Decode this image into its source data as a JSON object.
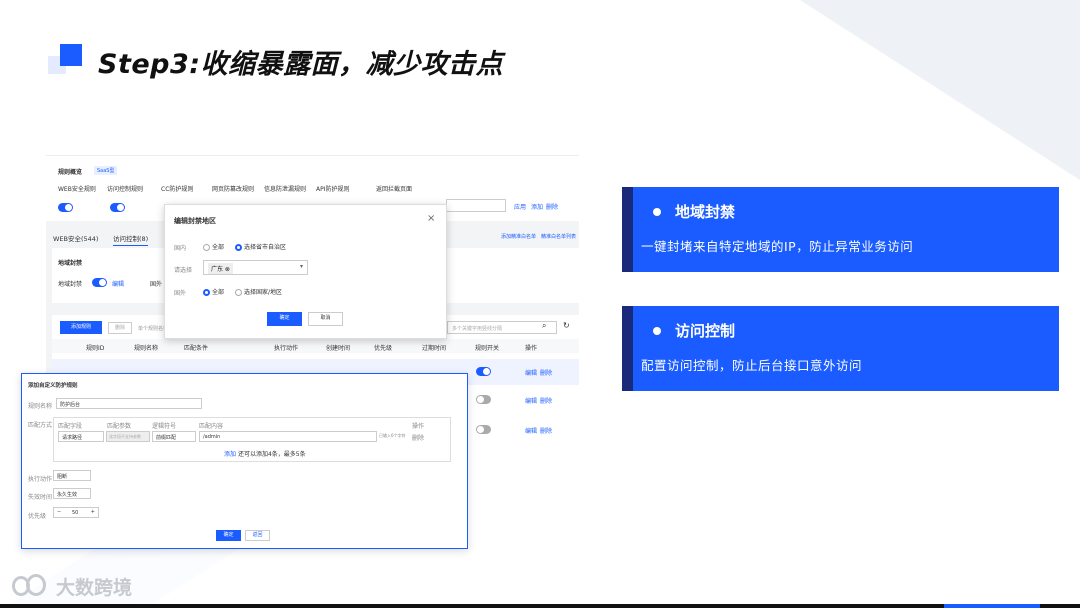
{
  "slide": {
    "title": "Step3:收缩暴露面，减少攻击点",
    "logo_text": "大数跨境"
  },
  "callouts": [
    {
      "heading": "地域封禁",
      "body": "一键封堵来自特定地域的IP，防止异常业务访问"
    },
    {
      "heading": "访问控制",
      "body": "配置访问控制，防止后台接口意外访问"
    }
  ],
  "screenshot": {
    "header": {
      "rule_overview": "规则概览",
      "saas_badge": "SaaS型",
      "rules": [
        "WEB安全规则",
        "访问控制规则",
        "CC防护规则",
        "网页防篡改规则",
        "信息防泄漏规则",
        "API防护规则",
        "返回拦截页面"
      ],
      "right_links": [
        "应用",
        "添加",
        "删除"
      ]
    },
    "tabs": [
      "WEB安全(544)",
      "访问控制(8)"
    ],
    "tab_right_links": [
      "添加精准白名单",
      "精准白名单列表"
    ],
    "geo_block": {
      "title": "地域封禁",
      "label": "地域封禁",
      "edit": "编辑",
      "overseas_label": "国外"
    },
    "toolbar": {
      "add_rule": "添加规则",
      "delete": "删除",
      "hint": "单个规则名称",
      "search_placeholder": "多个关键字用竖线分隔"
    },
    "table": {
      "headers": [
        "规则ID",
        "规则名称",
        "匹配条件",
        "执行动作",
        "创建时间",
        "优先级",
        "过期时间",
        "规则开关",
        "操作"
      ],
      "rows": [
        {
          "switch": true,
          "ops": [
            "编辑",
            "删除"
          ]
        },
        {
          "switch": false,
          "ops": [
            "编辑",
            "删除"
          ]
        },
        {
          "switch": false,
          "ops": [
            "编辑",
            "删除"
          ]
        }
      ]
    },
    "geo_modal": {
      "title": "编辑封禁地区",
      "domestic_label": "国内",
      "opt_all": "全部",
      "opt_select_region": "选择省市自治区",
      "select_label": "请选择",
      "selected_tag": "广东",
      "overseas_label": "国外",
      "opt_all_2": "全部",
      "opt_select_country": "选择国家/地区",
      "confirm": "确定",
      "cancel": "取消"
    },
    "custom_modal": {
      "title": "添加自定义防护规则",
      "name_label": "规则名称",
      "name_value": "防护后台",
      "match_label": "匹配方式",
      "cols": [
        "匹配字段",
        "匹配参数",
        "逻辑符号",
        "匹配内容",
        "操作"
      ],
      "row": {
        "field": "请求路径",
        "param": "该字段不支持参数",
        "logic": "前缀匹配",
        "content": "/admin",
        "limit": "已输入6个字符",
        "op": "删除"
      },
      "add_hint_link": "添加",
      "add_hint_text": "还可以添加4条，最多5条",
      "action_label": "执行动作",
      "action_value": "阻断",
      "expire_label": "失效时间",
      "expire_value": "永久生效",
      "priority_label": "优先级",
      "priority_value": "50",
      "confirm": "确定",
      "cancel": "返回"
    }
  },
  "colors": {
    "accent": "#1a5cff",
    "accent_dark": "#1a2a7a"
  }
}
